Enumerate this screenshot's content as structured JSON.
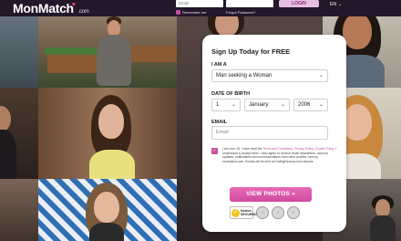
{
  "header": {
    "logo": "MonMatch",
    "logo_suffix": ".com",
    "email_placeholder": "Email",
    "password_placeholder": "",
    "login_label": "LOGIN",
    "remember_label": "Remember me",
    "forgot_label": "Forgot Password?",
    "language": "EN"
  },
  "form": {
    "title": "Sign Up Today for FREE",
    "iam_label": "I AM A",
    "iam_value": "Man seeking a Woman",
    "dob_label": "DATE OF BIRTH",
    "dob_day": "1",
    "dob_month": "January",
    "dob_year": "2006",
    "email_label": "EMAIL",
    "email_placeholder": "Email",
    "consent_pre": "I am over 18. I have read the",
    "consent_link1": "Terms and Conditions",
    "consent_mid1": ",",
    "consent_link2": "Privacy Policy",
    "consent_mid2": ",",
    "consent_link3": "Cookie Policy",
    "consent_post": ". I understand & accept them. I also agree to receive email newsletters, account updates, notifications and communications from other profiles, sent by monmatch.com. Emails will be sent by DatingFactory.com network.",
    "cta_label": "VIEW PHOTOS »",
    "norton_label_1": "Norton",
    "norton_label_2": "SECURED"
  },
  "colors": {
    "accent": "#c34f9e",
    "cta": "#d94fa8",
    "header_bg": "#23172a"
  }
}
